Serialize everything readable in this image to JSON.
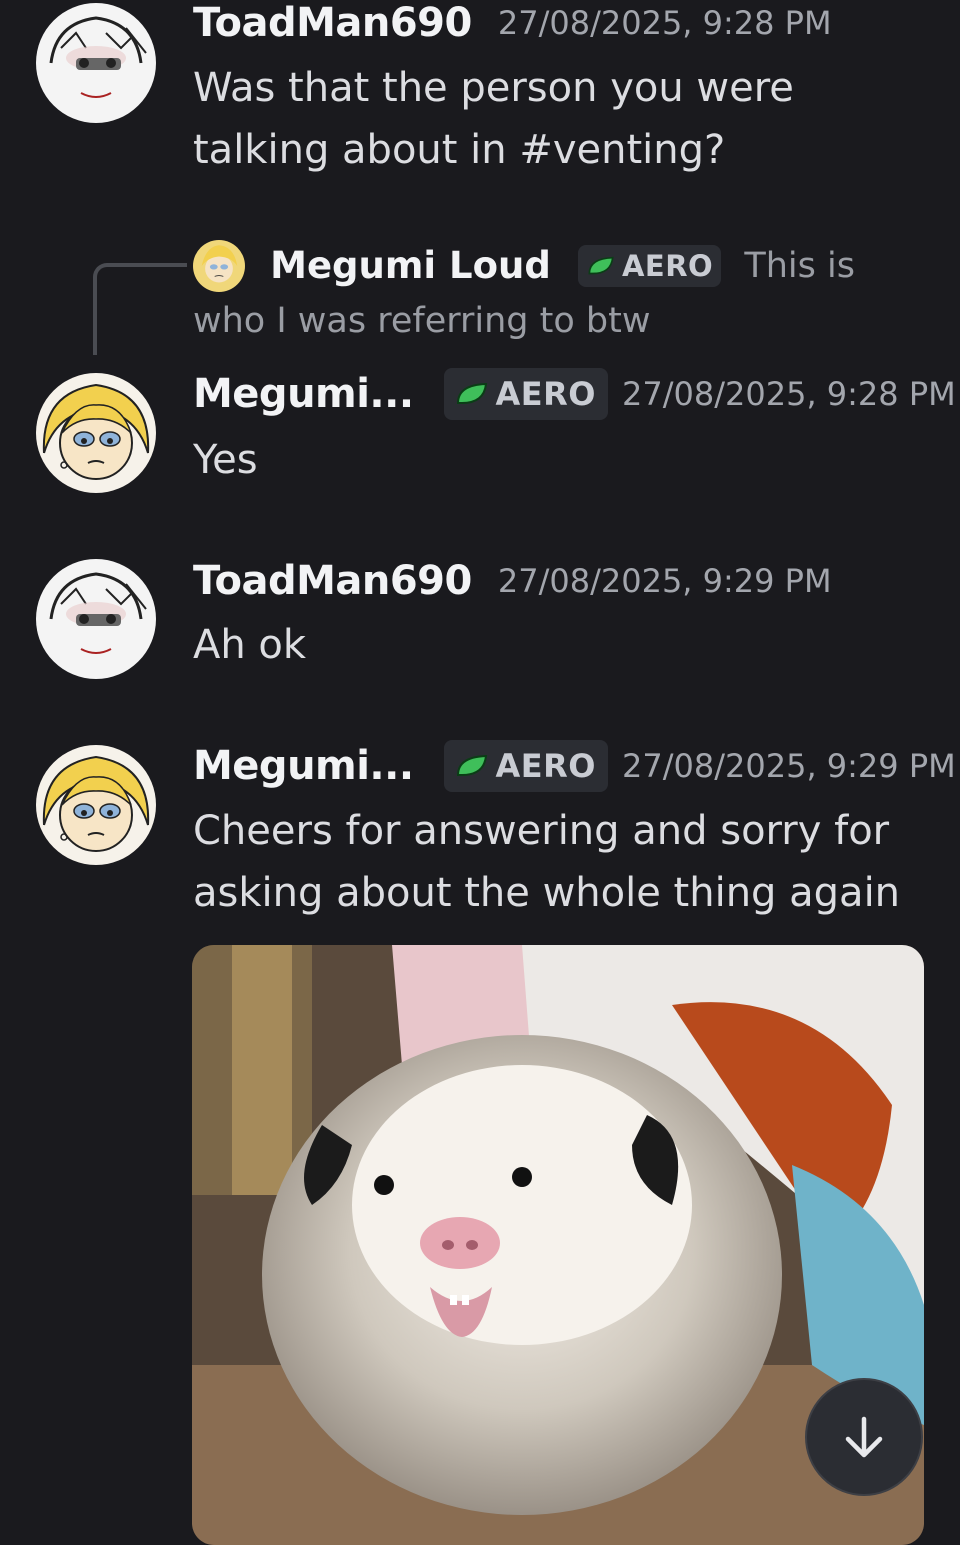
{
  "messages": [
    {
      "author": "ToadMan690",
      "timestamp": "27/08/2025, 9:28 PM",
      "text": "Was that the person you were talking about in #venting?"
    },
    {
      "reply": {
        "author": "Megumi Loud",
        "tag": "AERO",
        "text": "This is who I was referring to btw"
      },
      "author": "Megumi...",
      "tag": "AERO",
      "timestamp": "27/08/2025, 9:28 PM",
      "text": "Yes"
    },
    {
      "author": "ToadMan690",
      "timestamp": "27/08/2025, 9:29 PM",
      "text": "Ah ok"
    },
    {
      "author": "Megumi...",
      "tag": "AERO",
      "timestamp": "27/08/2025, 9:29 PM",
      "text": "Cheers for answering and sorry for asking about the whole thing again",
      "attachment": "opossum-gif"
    }
  ],
  "icons": {
    "tag": "leaf-icon",
    "jump": "arrow-down-icon"
  },
  "colors": {
    "background": "#1a1a1e",
    "tag_leaf": "#3fbf5a",
    "timestamp": "#a3a6ad"
  }
}
